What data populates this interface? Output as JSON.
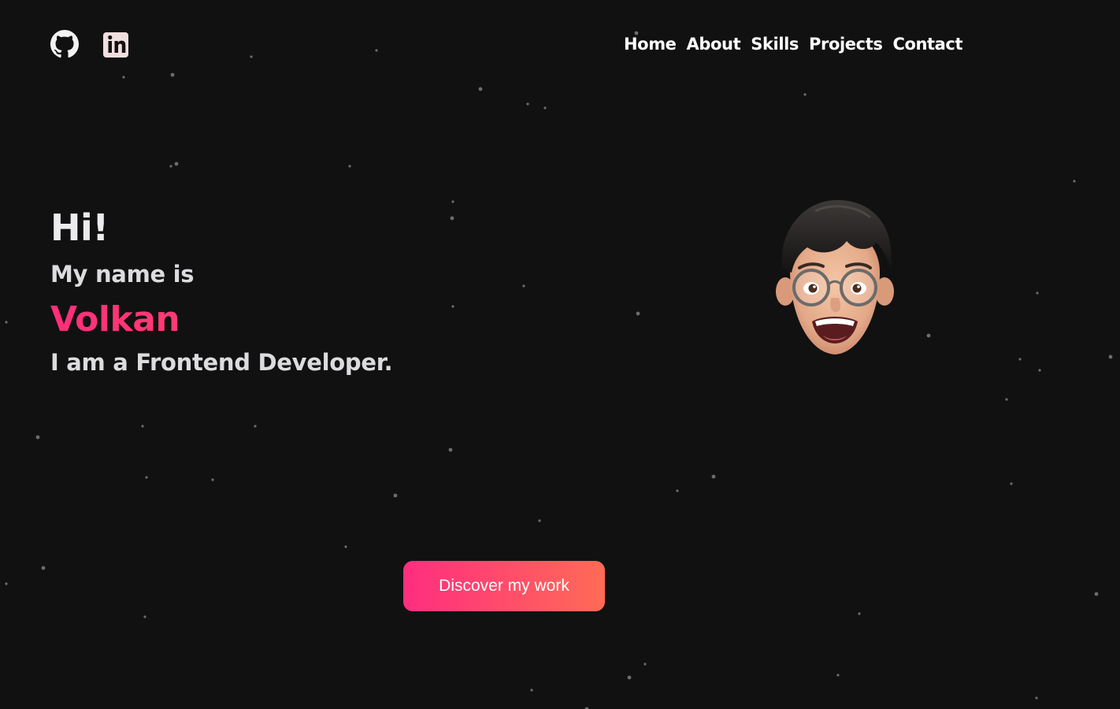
{
  "social": [
    {
      "label": "GitHub",
      "icon": "github-icon"
    },
    {
      "label": "LinkedIn",
      "icon": "linkedin-icon"
    }
  ],
  "nav": {
    "items": [
      "Home",
      "About",
      "Skills",
      "Projects",
      "Contact"
    ]
  },
  "hero": {
    "greeting": "Hi!",
    "intro": "My name is",
    "name": "Volkan",
    "role": "I am a Frontend Developer."
  },
  "cta": {
    "label": "Discover my work"
  },
  "colors": {
    "background": "#111112",
    "accent_start": "#ff2d80",
    "accent_end": "#ff6b55",
    "text": "#e8e8ea"
  }
}
